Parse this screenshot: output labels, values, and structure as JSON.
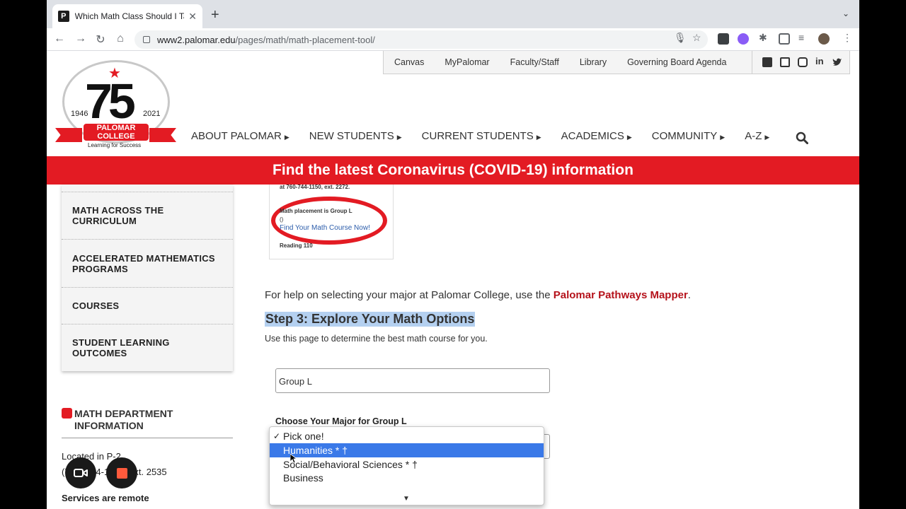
{
  "browser": {
    "tab_title": "Which Math Class Should I Take",
    "favicon_letter": "P",
    "new_tab": "+",
    "url_host": "www2.palomar.edu",
    "url_path": "/pages/math/math-placement-tool/"
  },
  "utility_nav": {
    "links": [
      "Canvas",
      "MyPalomar",
      "Faculty/Staff",
      "Library",
      "Governing Board Agenda"
    ]
  },
  "logo": {
    "number": "75",
    "year_start": "1946",
    "year_end": "2021",
    "name_line1": "PALOMAR",
    "name_line2": "COLLEGE",
    "tagline": "Learning for Success"
  },
  "main_nav": {
    "items": [
      "ABOUT PALOMAR",
      "NEW STUDENTS",
      "CURRENT STUDENTS",
      "ACADEMICS",
      "COMMUNITY",
      "A-Z"
    ]
  },
  "banner": "Find the latest Coronavirus (COVID-19) information",
  "sidebar": {
    "items": [
      "MATH ACROSS THE CURRICULUM",
      "ACCELERATED MATHEMATICS PROGRAMS",
      "COURSES",
      "STUDENT LEARNING OUTCOMES"
    ],
    "dept_title": "MATH DEPARTMENT INFORMATION",
    "location": "Located in P-2",
    "phone": "(760) 744-1150, ext. 2535",
    "services": "Services are remote"
  },
  "thumbnail": {
    "top_text": "at 760-744-1150, ext. 2272.",
    "placement_text": "Math placement is Group L",
    "paren": "()",
    "link": "Find Your Math Course Now!",
    "bottom_text": "Reading 110"
  },
  "content": {
    "help_prefix": "For help on selecting your major at Palomar College, use the ",
    "help_link": "Palomar Pathways Mapper",
    "help_suffix": ".",
    "step_title": "Step 3: Explore Your Math Options",
    "step_desc": "Use this page to determine the best math course for you.",
    "group_value": "Group L",
    "choose_label": "Choose Your Major for Group L"
  },
  "dropdown": {
    "options": [
      "Pick one!",
      "Humanities * †",
      "Social/Behavioral Sciences * †",
      "Business"
    ],
    "checked_index": 0,
    "highlighted_index": 1
  },
  "colors": {
    "brand_red": "#e31b23",
    "link_red": "#b5121b",
    "selection_blue": "#3a79e8",
    "highlight": "#b4d0f0"
  }
}
